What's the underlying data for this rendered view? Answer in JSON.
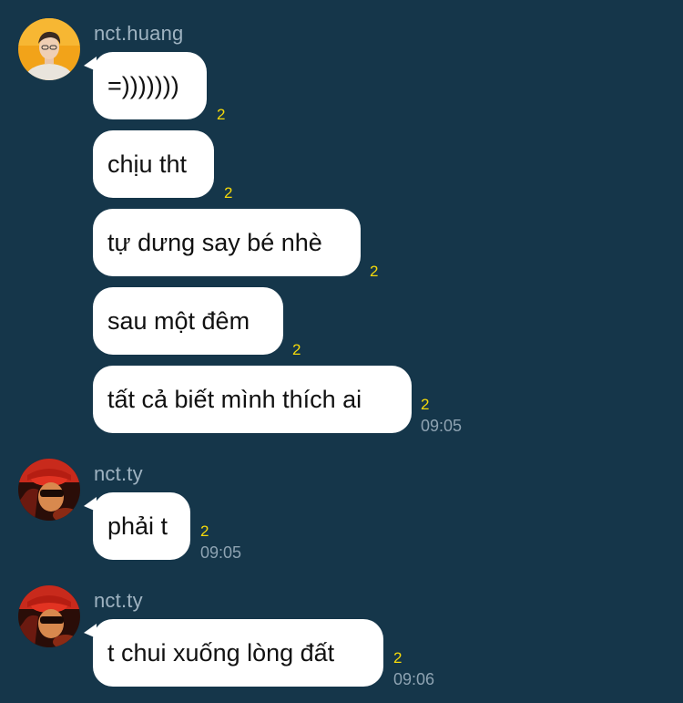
{
  "colors": {
    "background": "#15364a",
    "bubble": "#ffffff",
    "unread_count": "#f5d90a",
    "sender_name": "#9fb3c1",
    "timestamp": "#8ea3b2"
  },
  "groups": [
    {
      "sender": "nct.huang",
      "avatar_icon": "user-avatar-icon",
      "messages": [
        {
          "text": "=)))))))",
          "count": "2",
          "time": ""
        },
        {
          "text": "chịu tht",
          "count": "2",
          "time": ""
        },
        {
          "text": "tự dưng say bé nhè",
          "count": "2",
          "time": ""
        },
        {
          "text": "sau một đêm",
          "count": "2",
          "time": ""
        },
        {
          "text": "tất cả biết mình thích ai",
          "count": "2",
          "time": "09:05"
        }
      ]
    },
    {
      "sender": "nct.ty",
      "avatar_icon": "user-avatar-icon",
      "messages": [
        {
          "text": "phải t",
          "count": "2",
          "time": "09:05"
        }
      ]
    },
    {
      "sender": "nct.ty",
      "avatar_icon": "user-avatar-icon",
      "messages": [
        {
          "text": "t chui xuống lòng đất",
          "count": "2",
          "time": "09:06"
        }
      ]
    }
  ]
}
